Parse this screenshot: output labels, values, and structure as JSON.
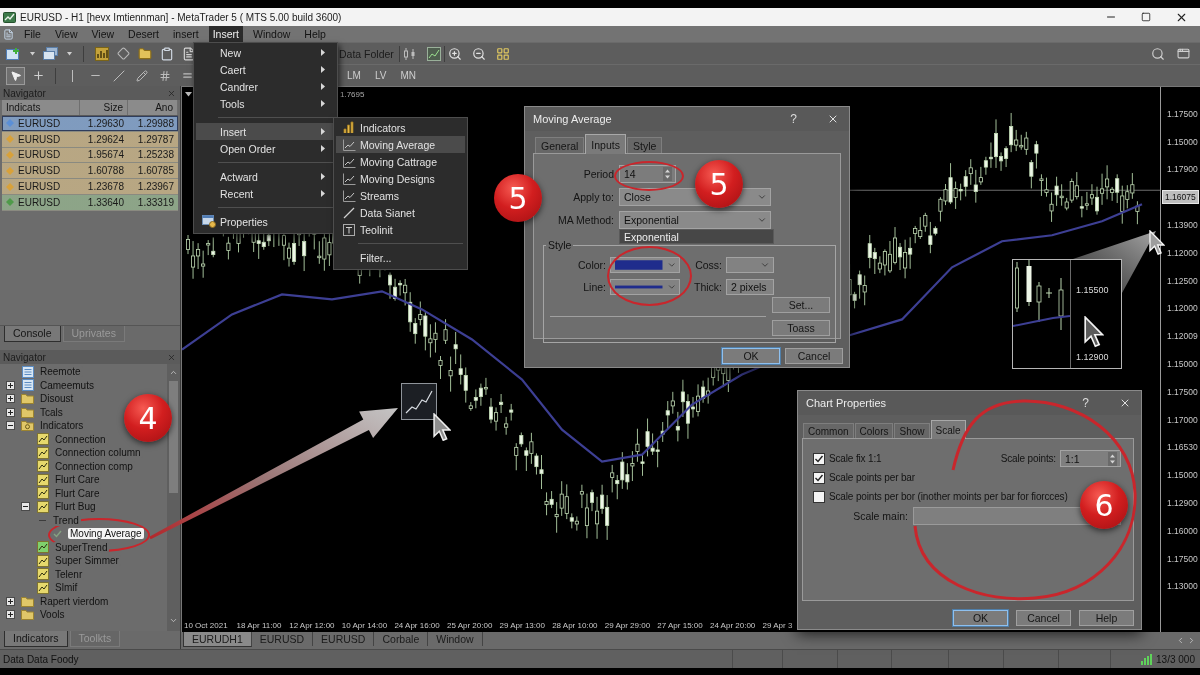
{
  "window": {
    "title": "EURUSD - H1 [hevx Imtiennman] - MetaTrader 5 ( MTS 5.00 build 3600)"
  },
  "menu_bar": [
    {
      "label": "File",
      "selected": false
    },
    {
      "label": "View",
      "selected": false
    },
    {
      "label": "View",
      "selected": false
    },
    {
      "label": "Desert",
      "selected": false
    },
    {
      "label": "insert",
      "selected": false
    },
    {
      "label": "Insert",
      "selected": true
    },
    {
      "label": "Window",
      "selected": false
    },
    {
      "label": "Help",
      "selected": false
    }
  ],
  "toolbar": {
    "data_folder": "Data Folder",
    "drawing_tools": [
      {
        "kind": "pointer",
        "selected": true
      },
      {
        "kind": "crosshair",
        "selected": false
      },
      {
        "kind": "vline",
        "selected": false
      },
      {
        "kind": "hline",
        "selected": false
      },
      {
        "kind": "trendline",
        "selected": false
      },
      {
        "kind": "pencil",
        "selected": false
      },
      {
        "kind": "channel",
        "selected": false
      },
      {
        "kind": "equidistant",
        "selected": false
      }
    ],
    "timeframes": [
      "LM",
      "LV",
      "MN"
    ]
  },
  "market_watch": {
    "title": "Navigator",
    "columns": [
      "Indicats",
      "Size",
      "Ano"
    ],
    "rows": [
      {
        "symbol": "EURUSD",
        "size": "1.29630",
        "ano": "1.29988",
        "selected": true,
        "color": "#5b8fd6"
      },
      {
        "symbol": "EURUSD",
        "size": "1.29624",
        "ano": "1.29787",
        "selected": false,
        "color": "#d8a13a"
      },
      {
        "symbol": "EURUSD",
        "size": "1.95674",
        "ano": "1.25238",
        "selected": false,
        "color": "#d8a13a"
      },
      {
        "symbol": "EURUSD",
        "size": "1.60788",
        "ano": "1.60785",
        "selected": false,
        "color": "#d8a13a"
      },
      {
        "symbol": "EURUSD",
        "size": "1.23678",
        "ano": "1.23967",
        "selected": false,
        "color": "#d8a13a"
      },
      {
        "symbol": "EURUSD",
        "size": "1.33640",
        "ano": "1.33319",
        "selected": false,
        "color": "#4f9a4a"
      }
    ]
  },
  "toolbox_tabs": [
    {
      "label": "Console",
      "selected": true
    },
    {
      "label": "Uprivates",
      "selected": false
    }
  ],
  "navigator": {
    "title": "Navigator",
    "items": [
      {
        "label": "Reemote",
        "kind": "list",
        "selected": false
      },
      {
        "label": "Cameemuts",
        "kind": "list",
        "expanded": false,
        "selected": false
      },
      {
        "label": "Disoust",
        "kind": "folder",
        "expanded": false,
        "selected": false
      },
      {
        "label": "Tcals",
        "kind": "folder",
        "expanded": false,
        "selected": false
      },
      {
        "label": "Indicators",
        "kind": "indicator_folder",
        "expanded": true,
        "selected": false,
        "children": [
          {
            "label": "Connection",
            "kind": "indicator",
            "selected": false
          },
          {
            "label": "Connection column",
            "kind": "indicator",
            "selected": false
          },
          {
            "label": "Connection comp",
            "kind": "indicator",
            "selected": false
          },
          {
            "label": "Flurt Care",
            "kind": "indicator",
            "selected": false
          },
          {
            "label": "Flurt Care",
            "kind": "indicator",
            "selected": false
          },
          {
            "label": "Flurt Bug",
            "kind": "indicator",
            "expanded": true,
            "selected": false,
            "children": [
              {
                "label": "Trend",
                "kind": "branch",
                "selected": false
              },
              {
                "label": "Moving Average",
                "kind": "check",
                "selected": true
              }
            ]
          },
          {
            "label": "SuperTrend",
            "kind": "custom_indicator",
            "selected": false
          },
          {
            "label": "Super Simmer",
            "kind": "indicator",
            "selected": false
          },
          {
            "label": "Telenr",
            "kind": "indicator",
            "selected": false
          },
          {
            "label": "Slmif",
            "kind": "indicator",
            "selected": false
          }
        ]
      },
      {
        "label": "Rapert vierdom",
        "kind": "folder",
        "expanded": false,
        "selected": false
      },
      {
        "label": "Vools",
        "kind": "folder",
        "expanded": false,
        "selected": false
      }
    ]
  },
  "navigator_tabs": [
    {
      "label": "Indicators",
      "selected": true
    },
    {
      "label": "Toolkts",
      "selected": false
    }
  ],
  "chart": {
    "header_value": "1.7695",
    "price_axis": [
      {
        "label": "1.17500",
        "kind": "tick"
      },
      {
        "label": "1.15000",
        "kind": "tick"
      },
      {
        "label": "1.17900",
        "kind": "tick"
      },
      {
        "label": "1.16075",
        "kind": "current"
      },
      {
        "label": "1.13900",
        "kind": "tick"
      },
      {
        "label": "1.12000",
        "kind": "tick"
      },
      {
        "label": "1.12500",
        "kind": "tick"
      },
      {
        "label": "1.12000",
        "kind": "tick"
      },
      {
        "label": "1.12009",
        "kind": "tick"
      },
      {
        "label": "1.15000",
        "kind": "tick"
      },
      {
        "label": "1.17500",
        "kind": "tick"
      },
      {
        "label": "1.17000",
        "kind": "tick"
      },
      {
        "label": "1.16530",
        "kind": "tick"
      },
      {
        "label": "1.15000",
        "kind": "tick"
      },
      {
        "label": "1.12900",
        "kind": "tick"
      },
      {
        "label": "1.16000",
        "kind": "tick"
      },
      {
        "label": "1.17500",
        "kind": "tick"
      },
      {
        "label": "1.13000",
        "kind": "tick"
      }
    ],
    "time_axis": [
      "10 Oct 2021",
      "18 Apr 11:00",
      "12 Apr 12:00",
      "10 Apr 14:00",
      "24 Apr 16:00",
      "25 Apr 20:00",
      "29 Apr 13:00",
      "28 Apr 10:00",
      "29 Apr 29:00",
      "27 Apr 15:00",
      "24 Apr 20:00",
      "29 Apr 3"
    ],
    "inset": {
      "labels": [
        "1.15500",
        "1.12900"
      ]
    },
    "tabs": [
      {
        "label": "EURUDH1",
        "selected": true
      },
      {
        "label": "EURUSD",
        "selected": false
      },
      {
        "label": "EURUSD",
        "selected": false
      },
      {
        "label": "Corbale",
        "selected": false
      },
      {
        "label": "Window",
        "selected": false
      }
    ]
  },
  "status_bar": {
    "text": "Data Data Foody",
    "info": "13/3 000"
  },
  "insert_menu": {
    "groups": [
      [
        {
          "label": "New",
          "kind": "submenu",
          "selected": false
        },
        {
          "label": "Caert",
          "kind": "submenu",
          "selected": false
        },
        {
          "label": "Candrer",
          "kind": "submenu",
          "selected": false
        },
        {
          "label": "Tools",
          "kind": "submenu",
          "selected": false
        }
      ],
      [
        {
          "label": "Insert",
          "kind": "submenu",
          "selected": true
        },
        {
          "label": "Open Order",
          "kind": "submenu",
          "selected": false
        }
      ],
      [
        {
          "label": "Actward",
          "kind": "submenu",
          "selected": false
        },
        {
          "label": "Recent",
          "kind": "submenu",
          "selected": false
        }
      ],
      [
        {
          "label": "Properties",
          "kind": "command",
          "selected": false
        }
      ]
    ]
  },
  "insert_submenu": {
    "groups": [
      [
        {
          "label": "Indicators",
          "kind": "folder",
          "selected": false
        },
        {
          "label": "Moving Average",
          "kind": "indicator",
          "selected": true
        },
        {
          "label": "Moving Cattrage",
          "kind": "indicator",
          "selected": false
        },
        {
          "label": "Moving Designs",
          "kind": "indicator",
          "selected": false
        },
        {
          "label": "Streams",
          "kind": "indicator",
          "selected": false
        },
        {
          "label": "Data Sianet",
          "kind": "line",
          "selected": false
        },
        {
          "label": "Teolinit",
          "kind": "tool",
          "selected": false
        }
      ],
      [
        {
          "label": "Filter...",
          "kind": "plain",
          "selected": false
        }
      ]
    ]
  },
  "ma_dialog": {
    "title": "Moving Average",
    "help": "?",
    "tabs": [
      {
        "label": "General",
        "selected": false
      },
      {
        "label": "Inputs",
        "selected": true
      },
      {
        "label": "Style",
        "selected": false
      }
    ],
    "period": {
      "label": "Period",
      "value": "14"
    },
    "apply_to": {
      "label": "Apply to:",
      "value": "Close"
    },
    "ma_method": {
      "label": "MA Method:",
      "value": "Exponential",
      "expanded": true,
      "options": [
        "Exponential"
      ]
    },
    "style": {
      "legend": "Style",
      "color_field": {
        "label": "Color:",
        "color": "#1f2c8c"
      },
      "coss_field": {
        "label": "Coss:"
      },
      "line_field": {
        "label": "Line:"
      },
      "thick_field": {
        "label": "Thick:",
        "value": "2 pixels"
      },
      "buttons": [
        "Set...",
        "Toass"
      ]
    },
    "buttons": [
      {
        "label": "OK",
        "default": true
      },
      {
        "label": "Cancel",
        "default": false
      }
    ]
  },
  "chart_properties": {
    "title": "Chart Properties",
    "help": "?",
    "tabs": [
      {
        "label": "Common",
        "selected": false
      },
      {
        "label": "Colors",
        "selected": false
      },
      {
        "label": "Show",
        "selected": false
      },
      {
        "label": "Scale",
        "selected": true
      }
    ],
    "checkboxes": [
      {
        "label": "Scale fix 1:1",
        "checked": true
      },
      {
        "label": "Scale points per bar",
        "checked": true
      },
      {
        "label": "Scale points per bor (inother moints per bar for fiorcces)",
        "checked": false
      }
    ],
    "scale_points": {
      "label": "Scale points:",
      "value": "1:1"
    },
    "scale_main": {
      "label": "Scale main:"
    },
    "buttons": [
      {
        "label": "OK",
        "default": true
      },
      {
        "label": "Cancel",
        "default": false
      },
      {
        "label": "Help",
        "default": false
      }
    ]
  },
  "annotations": {
    "badges": [
      "4",
      "5",
      "5",
      "6"
    ]
  }
}
